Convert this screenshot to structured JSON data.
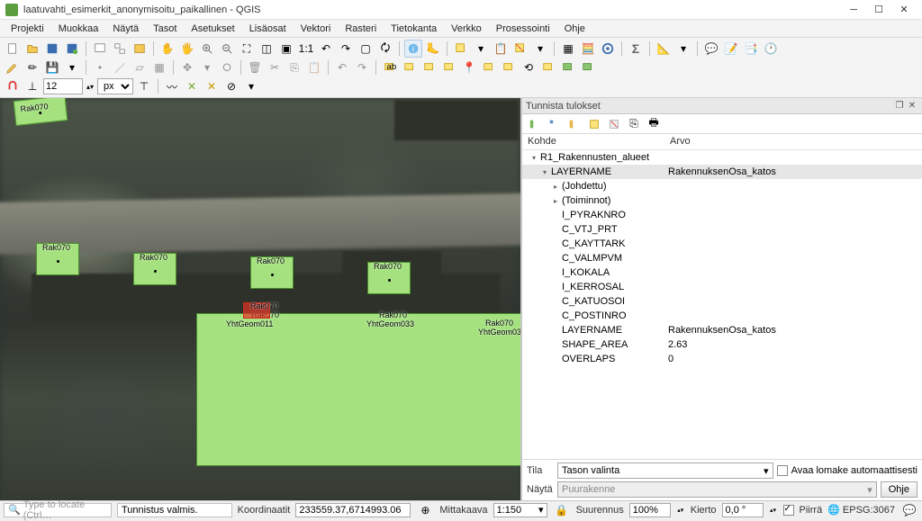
{
  "title": "laatuvahti_esimerkit_anonymisoitu_paikallinen - QGIS",
  "menu": [
    "Projekti",
    "Muokkaa",
    "Näytä",
    "Tasot",
    "Asetukset",
    "Lisäosat",
    "Vektori",
    "Rasteri",
    "Tietokanta",
    "Verkko",
    "Prosessointi",
    "Ohje"
  ],
  "scale_val": "12",
  "scale_unit": "px",
  "panel": {
    "title": "Tunnista tulokset",
    "head1": "Kohde",
    "head2": "Arvo",
    "rows": [
      {
        "ind": 8,
        "arr": "v",
        "k": "R1_Rakennusten_alueet",
        "v": ""
      },
      {
        "ind": 20,
        "arr": "v",
        "k": "LAYERNAME",
        "v": "RakennuksenOsa_katos",
        "sel": true
      },
      {
        "ind": 32,
        "arr": ">",
        "k": "(Johdettu)",
        "v": ""
      },
      {
        "ind": 32,
        "arr": ">",
        "k": "(Toiminnot)",
        "v": ""
      },
      {
        "ind": 32,
        "arr": "",
        "k": "I_PYRAKNRO",
        "v": ""
      },
      {
        "ind": 32,
        "arr": "",
        "k": "C_VTJ_PRT",
        "v": ""
      },
      {
        "ind": 32,
        "arr": "",
        "k": "C_KAYTTARK",
        "v": ""
      },
      {
        "ind": 32,
        "arr": "",
        "k": "C_VALMPVM",
        "v": ""
      },
      {
        "ind": 32,
        "arr": "",
        "k": "I_KOKALA",
        "v": ""
      },
      {
        "ind": 32,
        "arr": "",
        "k": "I_KERROSAL",
        "v": ""
      },
      {
        "ind": 32,
        "arr": "",
        "k": "C_KATUOSOI",
        "v": ""
      },
      {
        "ind": 32,
        "arr": "",
        "k": "C_POSTINRO",
        "v": ""
      },
      {
        "ind": 32,
        "arr": "",
        "k": "LAYERNAME",
        "v": "RakennuksenOsa_katos"
      },
      {
        "ind": 32,
        "arr": "",
        "k": "SHAPE_AREA",
        "v": "2.63"
      },
      {
        "ind": 32,
        "arr": "",
        "k": "OVERLAPS",
        "v": "0"
      }
    ],
    "tila_label": "Tila",
    "tila_value": "Tason valinta",
    "nayta_label": "Näytä",
    "nayta_value": "Puurakenne",
    "auto_open": "Avaa lomake automaattisesti",
    "ohje": "Ohje"
  },
  "labels": {
    "rak": "Rak070",
    "yht011": "YhtGeom011",
    "yht033": "YhtGeom033"
  },
  "status": {
    "locator": "Type to locate (Ctrl…",
    "msg": "Tunnistus valmis.",
    "coord_label": "Koordinaatit",
    "coord": "233559.37,6714993.06",
    "scale_label": "Mittakaava",
    "scale": "1:150",
    "zoom_label": "Suurennus",
    "zoom": "100%",
    "rot_label": "Kierto",
    "rot": "0,0 °",
    "render": "Piirrä",
    "epsg": "EPSG:3067"
  }
}
